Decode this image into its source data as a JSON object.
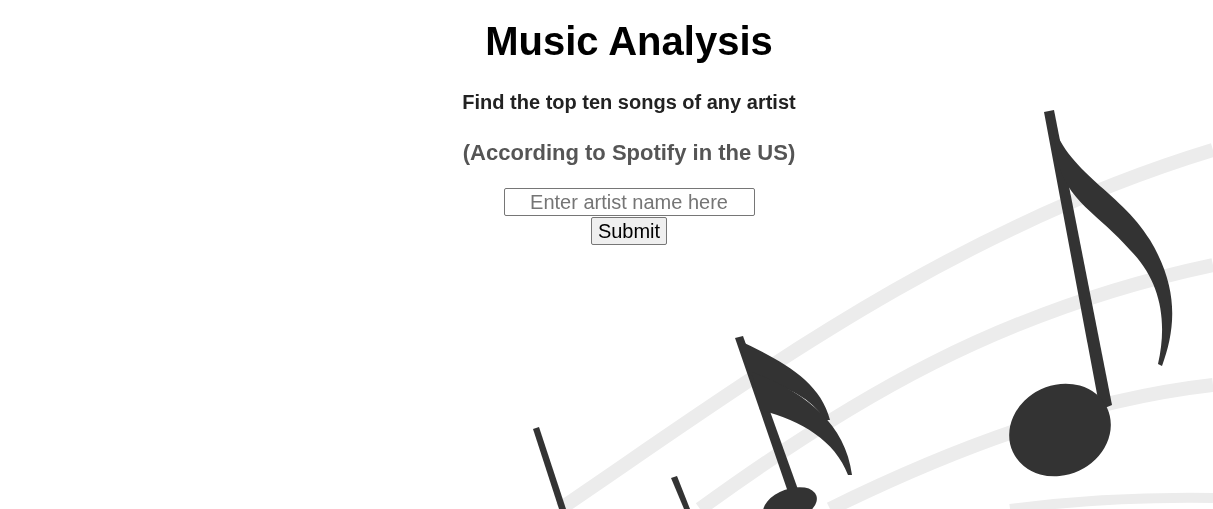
{
  "title": "Music Analysis",
  "subtitle": "Find the top ten songs of any artist",
  "note": "(According to Spotify in the US)",
  "search": {
    "placeholder": "Enter artist name here"
  },
  "submit_button": "Submit"
}
